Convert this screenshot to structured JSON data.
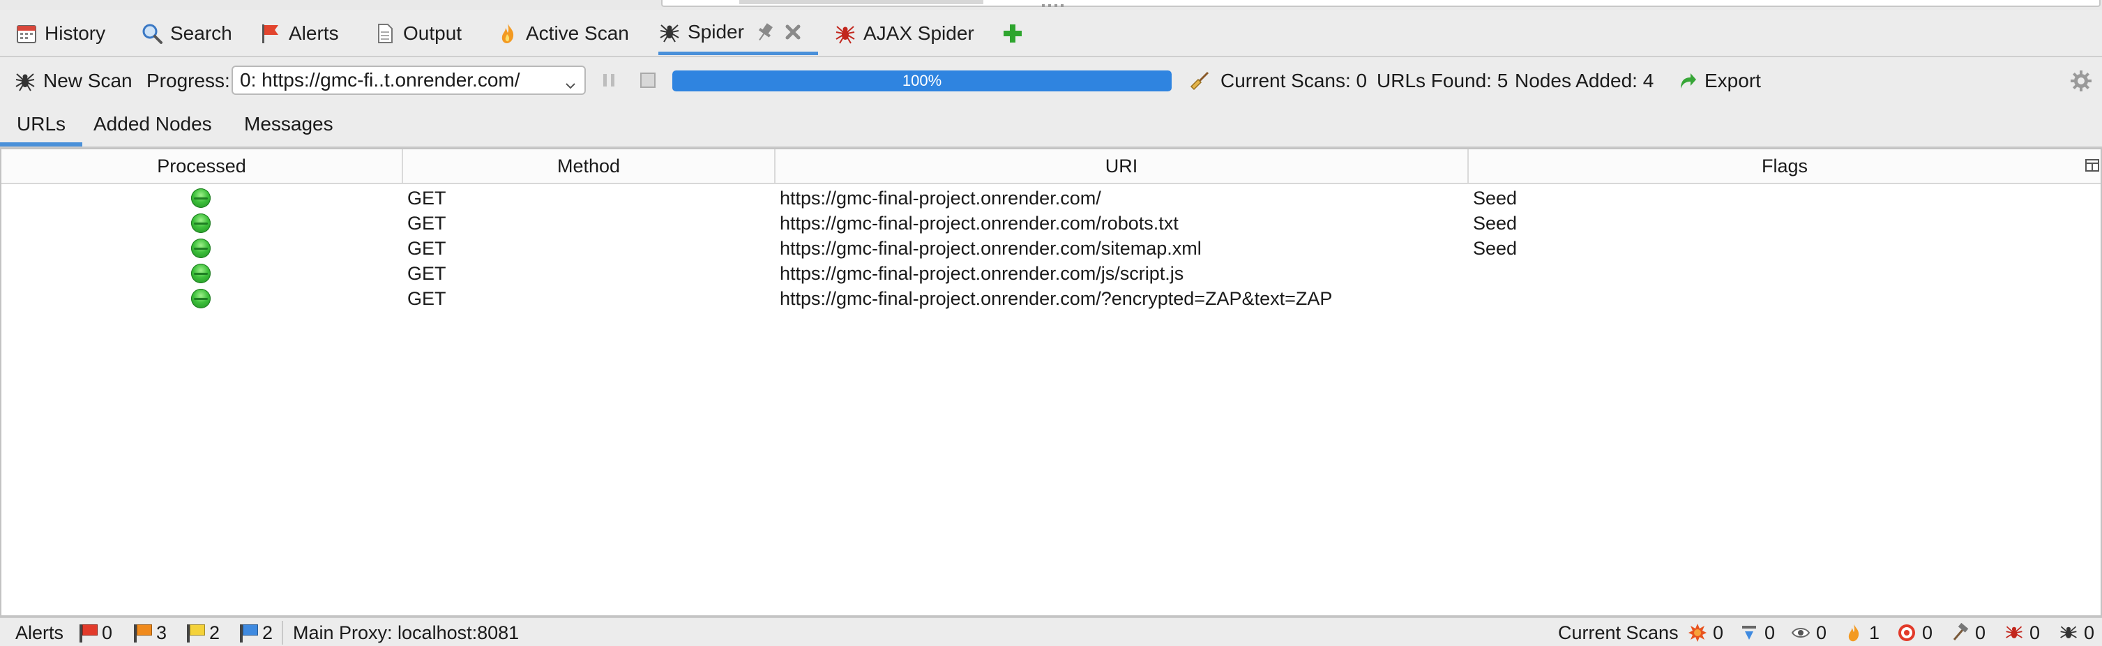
{
  "tabs": [
    {
      "label": "History",
      "icon": "calendar-icon"
    },
    {
      "label": "Search",
      "icon": "magnifier-icon"
    },
    {
      "label": "Alerts",
      "icon": "flag-icon"
    },
    {
      "label": "Output",
      "icon": "document-icon"
    },
    {
      "label": "Active Scan",
      "icon": "flame-icon"
    },
    {
      "label": "Spider",
      "icon": "spider-icon",
      "active": true
    },
    {
      "label": "AJAX Spider",
      "icon": "red-spider-icon"
    }
  ],
  "toolbar": {
    "new_scan_label": "New Scan",
    "progress_label": "Progress:",
    "scan_select_value": "0: https://gmc-fi..t.onrender.com/",
    "progress_percent": 100,
    "progress_text": "100%",
    "current_scans": "Current Scans: 0",
    "urls_found": "URLs Found: 5",
    "nodes_added": "Nodes Added: 4",
    "export_label": "Export"
  },
  "subtabs": [
    {
      "label": "URLs",
      "active": true
    },
    {
      "label": "Added Nodes"
    },
    {
      "label": "Messages"
    }
  ],
  "table": {
    "columns": [
      "Processed",
      "Method",
      "URI",
      "Flags"
    ],
    "rows": [
      {
        "processed": "green",
        "method": "GET",
        "uri": "https://gmc-final-project.onrender.com/",
        "flags": "Seed"
      },
      {
        "processed": "green",
        "method": "GET",
        "uri": "https://gmc-final-project.onrender.com/robots.txt",
        "flags": "Seed"
      },
      {
        "processed": "green",
        "method": "GET",
        "uri": "https://gmc-final-project.onrender.com/sitemap.xml",
        "flags": "Seed"
      },
      {
        "processed": "green",
        "method": "GET",
        "uri": "https://gmc-final-project.onrender.com/js/script.js",
        "flags": ""
      },
      {
        "processed": "green",
        "method": "GET",
        "uri": "https://gmc-final-project.onrender.com/?encrypted=ZAP&text=ZAP",
        "flags": ""
      }
    ]
  },
  "footer": {
    "alerts_label": "Alerts",
    "alert_counts": [
      {
        "icon": "red-flag-icon",
        "color": "#e23a2a",
        "count": "0"
      },
      {
        "icon": "orange-flag-icon",
        "color": "#f08a1c",
        "count": "3"
      },
      {
        "icon": "yellow-flag-icon",
        "color": "#f4d23a",
        "count": "2"
      },
      {
        "icon": "blue-flag-icon",
        "color": "#3f8ae0",
        "count": "2"
      }
    ],
    "proxy_text": "Main Proxy: localhost:8081",
    "current_scans_label": "Current Scans",
    "scan_counts": [
      {
        "icon": "burst-icon",
        "count": "0"
      },
      {
        "icon": "download-icon",
        "count": "0"
      },
      {
        "icon": "eye-icon",
        "count": "0"
      },
      {
        "icon": "flame-icon",
        "count": "1"
      },
      {
        "icon": "target-icon",
        "count": "0"
      },
      {
        "icon": "hammer-icon",
        "count": "0"
      },
      {
        "icon": "red-spider-icon",
        "count": "0"
      },
      {
        "icon": "spider-icon",
        "count": "0"
      }
    ]
  },
  "colors": {
    "accent": "#4a90d9",
    "progress_fill": "#2f84e0",
    "processed_ok": "#3cbf3a"
  }
}
